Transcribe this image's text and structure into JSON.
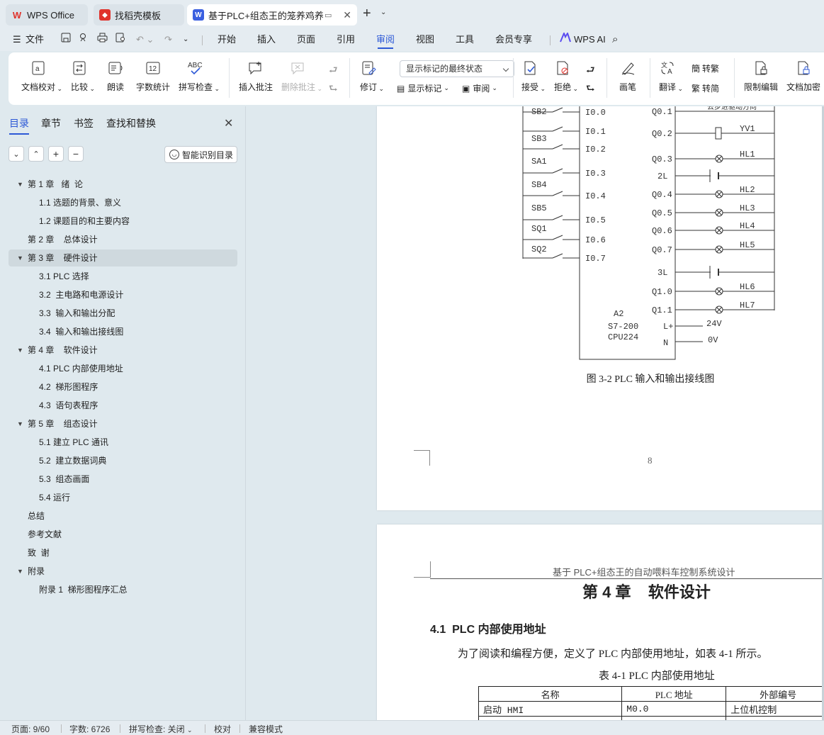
{
  "tabs": {
    "wps_office": "WPS Office",
    "templates": "找稻壳模板",
    "document": "基于PLC+组态王的笼养鸡养殖",
    "new_tab": "+"
  },
  "menu": {
    "file": "文件",
    "items": [
      "开始",
      "插入",
      "页面",
      "引用",
      "审阅",
      "视图",
      "工具",
      "会员专享"
    ],
    "active": "审阅",
    "wps_ai": "WPS AI"
  },
  "ribbon": {
    "proofread": "文档校对",
    "compare": "比较",
    "read_aloud": "朗读",
    "word_count": "字数统计",
    "spell_check": "拼写检查",
    "insert_comment": "插入批注",
    "delete_comment": "删除批注",
    "track_changes": "修订",
    "markup_state": "显示标记的最终状态",
    "show_markup": "显示标记",
    "review": "审阅",
    "accept": "接受",
    "reject": "拒绝",
    "pen": "画笔",
    "translate": "翻译",
    "to_traditional": "转繁",
    "to_simplified": "转简",
    "restrict_edit": "限制编辑",
    "encrypt": "文档加密"
  },
  "sidebar": {
    "tabs": [
      "目录",
      "章节",
      "书签",
      "查找和替换"
    ],
    "smart_toc": "智能识别目录",
    "toc": [
      {
        "label": "第 1 章   绪  论",
        "level": 1,
        "expanded": true
      },
      {
        "label": "1.1 选题的背景、意义",
        "level": 2
      },
      {
        "label": "1.2 课题目的和主要内容",
        "level": 2
      },
      {
        "label": "第 2 章    总体设计",
        "level": 1
      },
      {
        "label": "第 3 章    硬件设计",
        "level": 1,
        "expanded": true,
        "selected": true
      },
      {
        "label": "3.1 PLC 选择",
        "level": 2
      },
      {
        "label": "3.2  主电路和电源设计",
        "level": 2
      },
      {
        "label": "3.3  输入和输出分配",
        "level": 2
      },
      {
        "label": "3.4  输入和输出接线图",
        "level": 2
      },
      {
        "label": "第 4 章    软件设计",
        "level": 1,
        "expanded": true
      },
      {
        "label": "4.1 PLC 内部使用地址",
        "level": 2
      },
      {
        "label": "4.2  梯形图程序",
        "level": 2
      },
      {
        "label": "4.3  语句表程序",
        "level": 2
      },
      {
        "label": "第 5 章    组态设计",
        "level": 1,
        "expanded": true
      },
      {
        "label": "5.1 建立 PLC 通讯",
        "level": 2
      },
      {
        "label": "5.2  建立数据词典",
        "level": 2
      },
      {
        "label": "5.3  组态画面",
        "level": 2
      },
      {
        "label": "5.4 运行",
        "level": 2
      },
      {
        "label": "总结",
        "level": 1
      },
      {
        "label": "参考文献",
        "level": 1
      },
      {
        "label": "致  谢",
        "level": 1
      },
      {
        "label": "附录",
        "level": 1,
        "expanded": true
      },
      {
        "label": "附录 1  梯形图程序汇总",
        "level": 2
      }
    ]
  },
  "page1": {
    "inputs": [
      {
        "label": "SB2",
        "addr": "I0.0"
      },
      {
        "label": "",
        "addr": "I0.1"
      },
      {
        "label": "SB3",
        "addr": "I0.2"
      },
      {
        "label": "SA1",
        "addr": "I0.3"
      },
      {
        "label": "SB4",
        "addr": "I0.4"
      },
      {
        "label": "SB5",
        "addr": "I0.5"
      },
      {
        "label": "SQ1",
        "addr": "I0.6"
      },
      {
        "label": "SQ2",
        "addr": "I0.7"
      }
    ],
    "outputs": [
      {
        "addr": "Q0.1",
        "label": "去步进驱动方向"
      },
      {
        "addr": "Q0.2",
        "label": "YV1"
      },
      {
        "addr": "Q0.3",
        "label": "HL1"
      },
      {
        "addr": "2L",
        "label": ""
      },
      {
        "addr": "Q0.4",
        "label": "HL2"
      },
      {
        "addr": "Q0.5",
        "label": "HL3"
      },
      {
        "addr": "Q0.6",
        "label": "HL4"
      },
      {
        "addr": "Q0.7",
        "label": "HL5"
      },
      {
        "addr": "3L",
        "label": ""
      },
      {
        "addr": "Q1.0",
        "label": "HL6"
      },
      {
        "addr": "Q1.1",
        "label": "HL7"
      }
    ],
    "plc_id": "A2",
    "plc_model": "S7-200",
    "plc_cpu": "CPU224",
    "l_plus": "L+",
    "n": "N",
    "v24": "24V",
    "v0": "0V",
    "caption": "图 3-2 PLC 输入和输出接线图",
    "page_number": "8"
  },
  "page2": {
    "header": "基于 PLC+组态王的自动喂料车控制系统设计",
    "chapter": "第 4 章    软件设计",
    "section": "4.1  PLC 内部使用地址",
    "paragraph": "为了阅读和编程方便，定义了 PLC 内部使用地址，如表 4-1 所示。",
    "table_caption": "表 4-1 PLC 内部使用地址",
    "table_headers": [
      "名称",
      "PLC 地址",
      "外部编号"
    ],
    "table_rows": [
      [
        "启动 HMI",
        "M0.0",
        "上位机控制"
      ]
    ]
  },
  "status": {
    "page": "页面: 9/60",
    "words": "字数: 6726",
    "spell": "拼写检查: 关闭",
    "proof": "校对",
    "compat": "兼容模式"
  },
  "colors": {
    "accent": "#2d59d6",
    "wps_red": "#e0332c",
    "doc_blue": "#3a5fe0"
  }
}
